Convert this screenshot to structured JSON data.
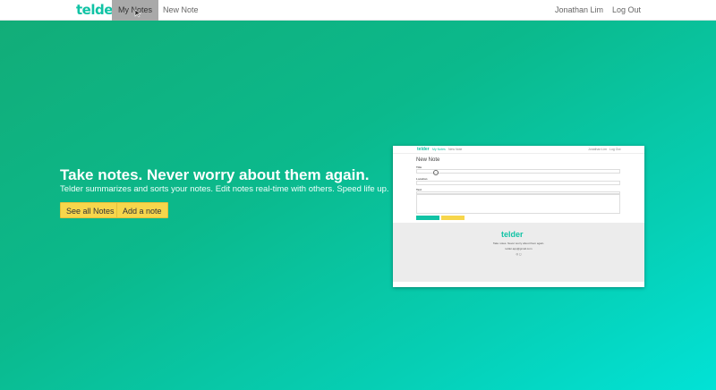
{
  "navbar": {
    "brand": "telder",
    "links": [
      {
        "label": "My Notes",
        "active": true
      },
      {
        "label": "New Note",
        "active": false
      }
    ],
    "user": "Jonathan Lim",
    "logout": "Log Out"
  },
  "hero": {
    "title": "Take notes. Never worry about them again.",
    "subtitle": "Telder summarizes and sorts your notes. Edit notes real-time with others. Speed life up.",
    "buttons": {
      "see_all": "See all Notes",
      "add": "Add a note"
    }
  },
  "preview": {
    "brand": "telder",
    "links": [
      "My Notes",
      "New Note"
    ],
    "user": "Jonathan Lim",
    "logout": "Log Out",
    "heading": "New Note",
    "labels": [
      "Title",
      "Location",
      "Text"
    ],
    "footer_brand": "telder",
    "footer_tagline": "Take notes. Never worry about them again.",
    "footer_email": "telder.app@gmail.com"
  },
  "colors": {
    "brand": "#11c3a5",
    "button": "#f7d64b",
    "active_nav": "#a9a9a9"
  }
}
